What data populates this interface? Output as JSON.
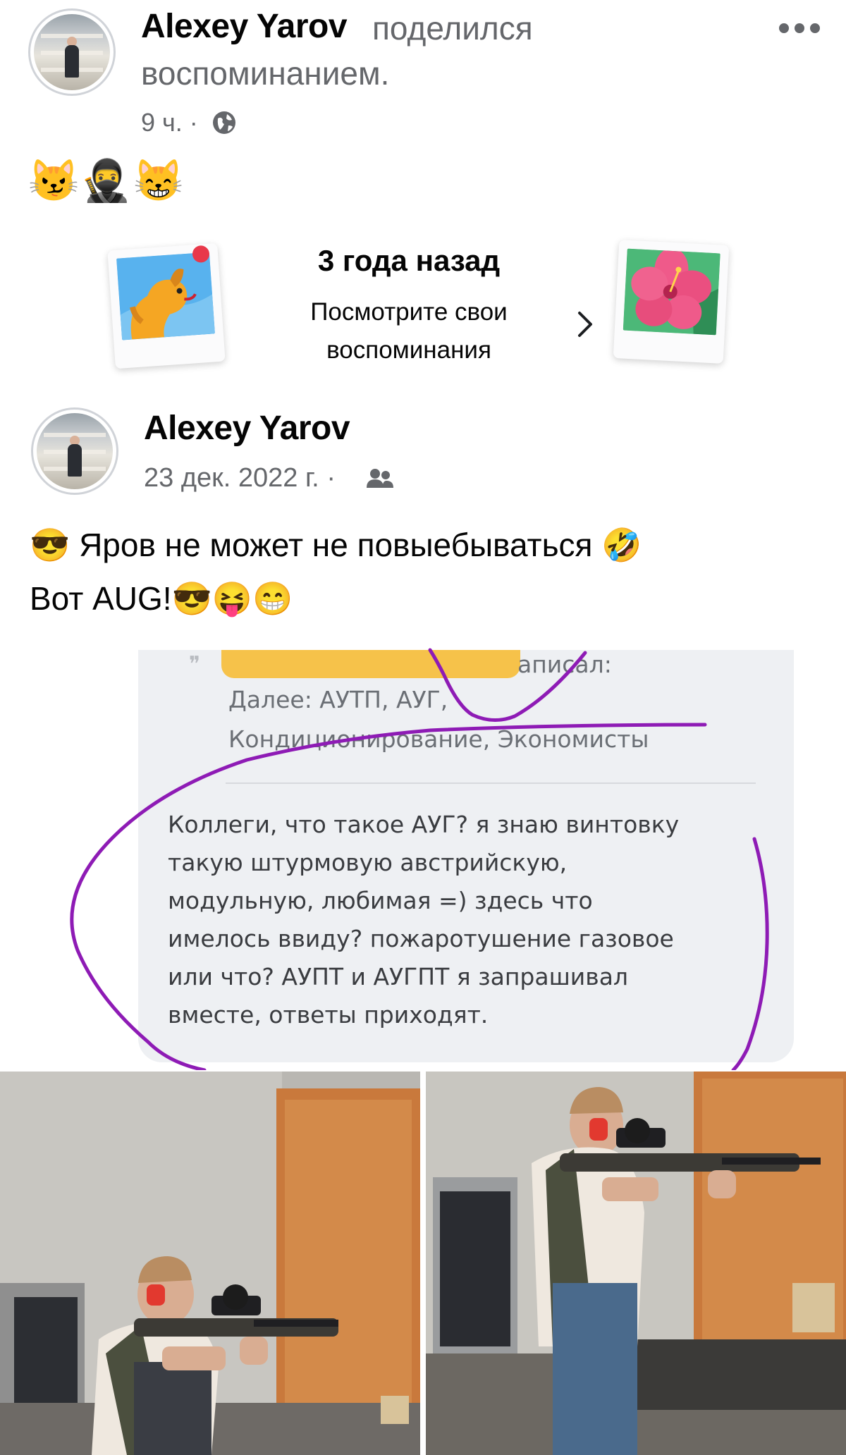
{
  "share_header": {
    "author": "Alexey Yarov",
    "action_line1": "поделился",
    "action_line2": "воспоминанием.",
    "time": "9 ч.",
    "separator": "·",
    "privacy_icon": "globe-icon",
    "more_icon": "more-dots-icon",
    "emojis": [
      "😼",
      "🥷",
      "😸"
    ]
  },
  "memory_card": {
    "title": "3 года назад",
    "subtitle_line1": "Посмотрите свои",
    "subtitle_line2": "воспоминания",
    "chevron": "›"
  },
  "original_post": {
    "author": "Alexey Yarov",
    "date": "23 дек. 2022 г.",
    "separator": "·",
    "audience_icon": "friends-icon",
    "line1_emoji_start": "😎",
    "line1_text": "Яров не может не повыебываться",
    "line1_emoji_end": "🤣",
    "line2_text": "Вот AUG!",
    "line2_emojis": "😎😝😁"
  },
  "quoted_screenshot": {
    "quote_mark": "❞",
    "quote_author_suffix": "аписал:",
    "quote_line1": "Далее: АУТП, АУГ,",
    "quote_line2": "Кондиционирование, Экономисты",
    "reply_lines": [
      "Коллеги, что такое АУГ? я знаю винтовку",
      "такую штурмовую австрийскую,",
      "модульную, любимая =) здесь что",
      "имелось ввиду? пожаротушение газовое",
      "или что? АУПТ и АУГПТ я запрашивал",
      "вместе, ответы приходят."
    ],
    "highlight_color": "#f6c24a",
    "annotation_color": "#8e1bb5"
  },
  "colors": {
    "text_primary": "#050505",
    "text_secondary": "#65676b",
    "inset_bg": "#eef0f3"
  }
}
